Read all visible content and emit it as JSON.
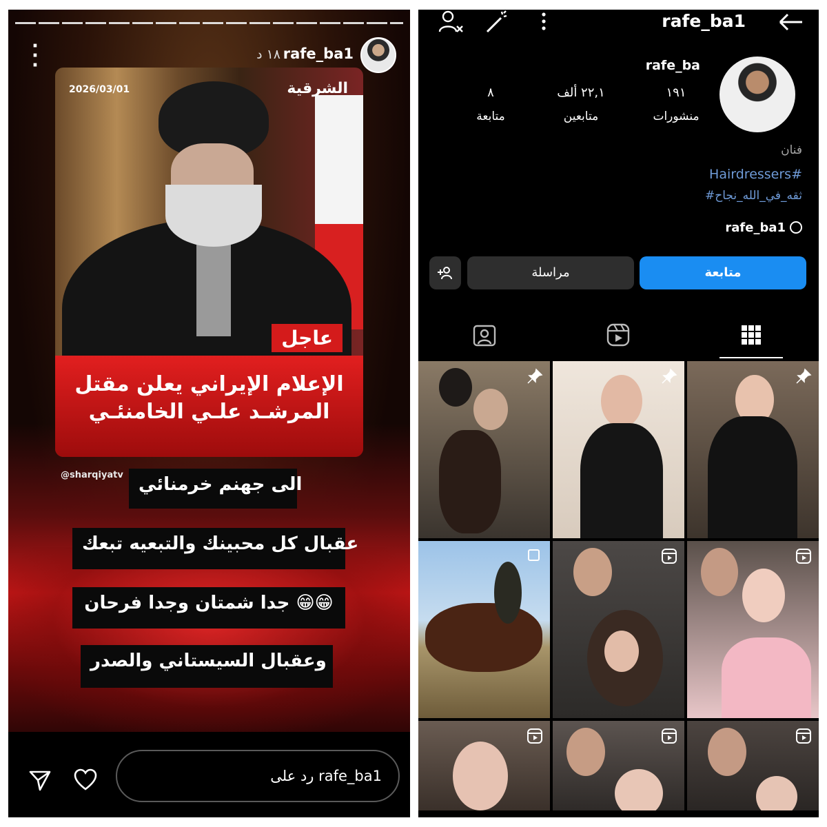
{
  "story": {
    "username": "rafe_ba1",
    "time": "١٨ د",
    "card": {
      "date": "2026/03/01",
      "logo": "الشرقية",
      "breaking": "عاجل",
      "headline_1": "الإعلام الإيراني يعلن مقتل",
      "headline_2": "المرشـد علـي الخامنئـي"
    },
    "handle": "@sharqiyatv",
    "captions": [
      "الى جهنم خرمنائي",
      "عقبال كل محبينك والتبعيه تبعك",
      "جدا شمتان وجدا فرحان 😁😁",
      "وعقبال السيستاني والصدر"
    ],
    "reply_placeholder": "رد على rafe_ba1"
  },
  "profile": {
    "title": "rafe_ba1",
    "name": "rafe_ba",
    "stats": [
      {
        "num": "١٩١",
        "label": "منشورات"
      },
      {
        "num": "٢٢,١ ألف",
        "label": "متابعين"
      },
      {
        "num": "٨",
        "label": "متابعة"
      }
    ],
    "category": "فنان",
    "hashtag_1": "Hairdressers#",
    "hashtag_2": "#ثقه_في_الله_نجاح",
    "threads": "rafe_ba1",
    "follow_label": "متابعة",
    "message_label": "مراسلة"
  },
  "colors": {
    "accent_blue": "#1a8df2",
    "link_blue": "#6f9bd8",
    "breaking_red": "#d41b1b"
  }
}
